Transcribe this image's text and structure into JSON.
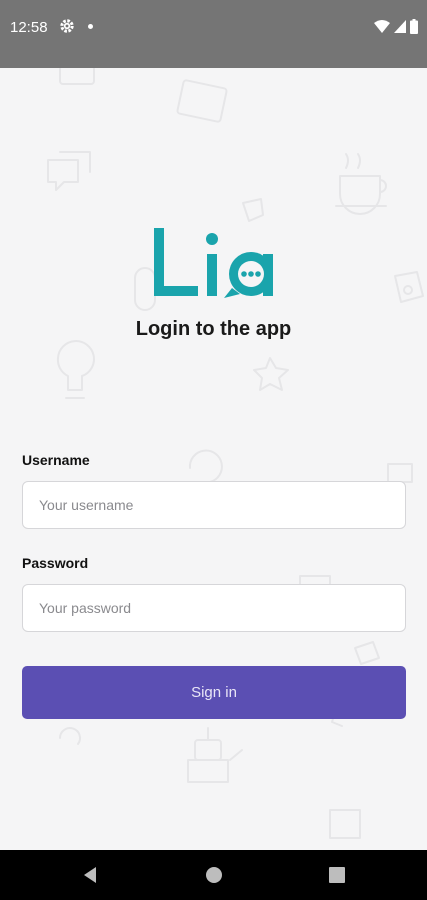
{
  "status_bar": {
    "time": "12:58"
  },
  "brand": {
    "logo_text": "Lia",
    "accent": "#1aa4ac",
    "subtitle": "Login to the app"
  },
  "form": {
    "username_label": "Username",
    "username_placeholder": "Your username",
    "username_value": "",
    "password_label": "Password",
    "password_placeholder": "Your password",
    "password_value": "",
    "signin_label": "Sign in",
    "button_color": "#5b4fb3"
  },
  "nav_bar": {
    "icons": [
      "back-icon",
      "home-icon",
      "recents-icon"
    ]
  }
}
